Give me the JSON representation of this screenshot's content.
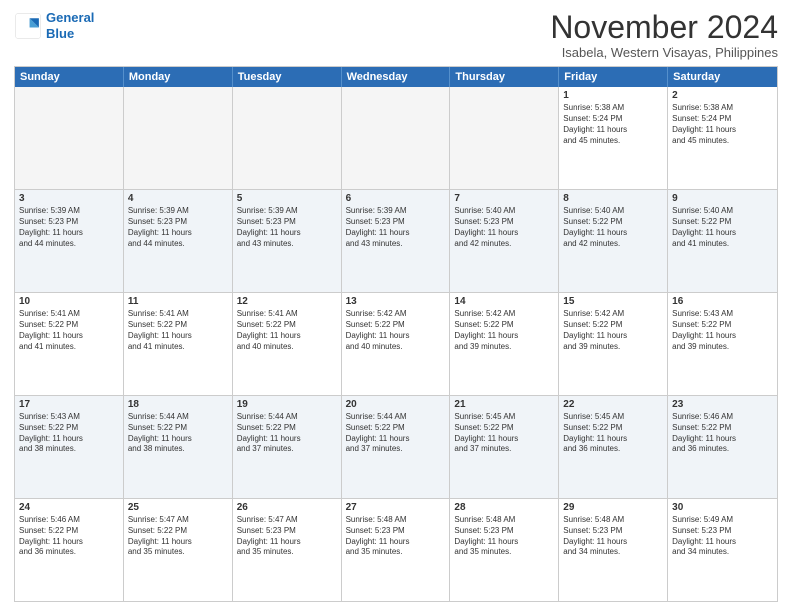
{
  "logo": {
    "line1": "General",
    "line2": "Blue"
  },
  "title": "November 2024",
  "subtitle": "Isabela, Western Visayas, Philippines",
  "calendar": {
    "headers": [
      "Sunday",
      "Monday",
      "Tuesday",
      "Wednesday",
      "Thursday",
      "Friday",
      "Saturday"
    ],
    "rows": [
      [
        {
          "day": "",
          "info": "",
          "empty": true
        },
        {
          "day": "",
          "info": "",
          "empty": true
        },
        {
          "day": "",
          "info": "",
          "empty": true
        },
        {
          "day": "",
          "info": "",
          "empty": true
        },
        {
          "day": "",
          "info": "",
          "empty": true
        },
        {
          "day": "1",
          "info": "Sunrise: 5:38 AM\nSunset: 5:24 PM\nDaylight: 11 hours\nand 45 minutes.",
          "empty": false
        },
        {
          "day": "2",
          "info": "Sunrise: 5:38 AM\nSunset: 5:24 PM\nDaylight: 11 hours\nand 45 minutes.",
          "empty": false
        }
      ],
      [
        {
          "day": "3",
          "info": "Sunrise: 5:39 AM\nSunset: 5:23 PM\nDaylight: 11 hours\nand 44 minutes.",
          "empty": false
        },
        {
          "day": "4",
          "info": "Sunrise: 5:39 AM\nSunset: 5:23 PM\nDaylight: 11 hours\nand 44 minutes.",
          "empty": false
        },
        {
          "day": "5",
          "info": "Sunrise: 5:39 AM\nSunset: 5:23 PM\nDaylight: 11 hours\nand 43 minutes.",
          "empty": false
        },
        {
          "day": "6",
          "info": "Sunrise: 5:39 AM\nSunset: 5:23 PM\nDaylight: 11 hours\nand 43 minutes.",
          "empty": false
        },
        {
          "day": "7",
          "info": "Sunrise: 5:40 AM\nSunset: 5:23 PM\nDaylight: 11 hours\nand 42 minutes.",
          "empty": false
        },
        {
          "day": "8",
          "info": "Sunrise: 5:40 AM\nSunset: 5:22 PM\nDaylight: 11 hours\nand 42 minutes.",
          "empty": false
        },
        {
          "day": "9",
          "info": "Sunrise: 5:40 AM\nSunset: 5:22 PM\nDaylight: 11 hours\nand 41 minutes.",
          "empty": false
        }
      ],
      [
        {
          "day": "10",
          "info": "Sunrise: 5:41 AM\nSunset: 5:22 PM\nDaylight: 11 hours\nand 41 minutes.",
          "empty": false
        },
        {
          "day": "11",
          "info": "Sunrise: 5:41 AM\nSunset: 5:22 PM\nDaylight: 11 hours\nand 41 minutes.",
          "empty": false
        },
        {
          "day": "12",
          "info": "Sunrise: 5:41 AM\nSunset: 5:22 PM\nDaylight: 11 hours\nand 40 minutes.",
          "empty": false
        },
        {
          "day": "13",
          "info": "Sunrise: 5:42 AM\nSunset: 5:22 PM\nDaylight: 11 hours\nand 40 minutes.",
          "empty": false
        },
        {
          "day": "14",
          "info": "Sunrise: 5:42 AM\nSunset: 5:22 PM\nDaylight: 11 hours\nand 39 minutes.",
          "empty": false
        },
        {
          "day": "15",
          "info": "Sunrise: 5:42 AM\nSunset: 5:22 PM\nDaylight: 11 hours\nand 39 minutes.",
          "empty": false
        },
        {
          "day": "16",
          "info": "Sunrise: 5:43 AM\nSunset: 5:22 PM\nDaylight: 11 hours\nand 39 minutes.",
          "empty": false
        }
      ],
      [
        {
          "day": "17",
          "info": "Sunrise: 5:43 AM\nSunset: 5:22 PM\nDaylight: 11 hours\nand 38 minutes.",
          "empty": false
        },
        {
          "day": "18",
          "info": "Sunrise: 5:44 AM\nSunset: 5:22 PM\nDaylight: 11 hours\nand 38 minutes.",
          "empty": false
        },
        {
          "day": "19",
          "info": "Sunrise: 5:44 AM\nSunset: 5:22 PM\nDaylight: 11 hours\nand 37 minutes.",
          "empty": false
        },
        {
          "day": "20",
          "info": "Sunrise: 5:44 AM\nSunset: 5:22 PM\nDaylight: 11 hours\nand 37 minutes.",
          "empty": false
        },
        {
          "day": "21",
          "info": "Sunrise: 5:45 AM\nSunset: 5:22 PM\nDaylight: 11 hours\nand 37 minutes.",
          "empty": false
        },
        {
          "day": "22",
          "info": "Sunrise: 5:45 AM\nSunset: 5:22 PM\nDaylight: 11 hours\nand 36 minutes.",
          "empty": false
        },
        {
          "day": "23",
          "info": "Sunrise: 5:46 AM\nSunset: 5:22 PM\nDaylight: 11 hours\nand 36 minutes.",
          "empty": false
        }
      ],
      [
        {
          "day": "24",
          "info": "Sunrise: 5:46 AM\nSunset: 5:22 PM\nDaylight: 11 hours\nand 36 minutes.",
          "empty": false
        },
        {
          "day": "25",
          "info": "Sunrise: 5:47 AM\nSunset: 5:22 PM\nDaylight: 11 hours\nand 35 minutes.",
          "empty": false
        },
        {
          "day": "26",
          "info": "Sunrise: 5:47 AM\nSunset: 5:23 PM\nDaylight: 11 hours\nand 35 minutes.",
          "empty": false
        },
        {
          "day": "27",
          "info": "Sunrise: 5:48 AM\nSunset: 5:23 PM\nDaylight: 11 hours\nand 35 minutes.",
          "empty": false
        },
        {
          "day": "28",
          "info": "Sunrise: 5:48 AM\nSunset: 5:23 PM\nDaylight: 11 hours\nand 35 minutes.",
          "empty": false
        },
        {
          "day": "29",
          "info": "Sunrise: 5:48 AM\nSunset: 5:23 PM\nDaylight: 11 hours\nand 34 minutes.",
          "empty": false
        },
        {
          "day": "30",
          "info": "Sunrise: 5:49 AM\nSunset: 5:23 PM\nDaylight: 11 hours\nand 34 minutes.",
          "empty": false
        }
      ]
    ]
  }
}
